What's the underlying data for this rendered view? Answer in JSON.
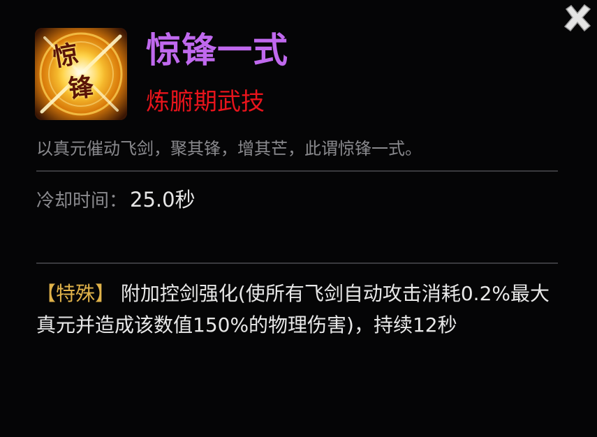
{
  "skill": {
    "icon": "feng-sword-icon",
    "icon_chars": [
      "惊",
      "锋"
    ],
    "name": "惊锋一式",
    "type": "炼腑期武技",
    "description": "以真元催动飞剑，聚其锋，增其芒，此谓惊锋一式。",
    "cooldown_label": "冷却时间：",
    "cooldown_value": "25.0秒",
    "effect_tag": "【特殊】",
    "effect_text": "附加控剑强化(使所有飞剑自动攻击消耗0.2%最大真元并造成该数值150%的物理伤害)，持续12秒"
  },
  "colors": {
    "name": "#c069ee",
    "type": "#e8141c",
    "tag": "#e0b24a",
    "muted": "#8a8a8e",
    "text": "#e8e8e8"
  },
  "controls": {
    "close_icon": "close-icon"
  }
}
